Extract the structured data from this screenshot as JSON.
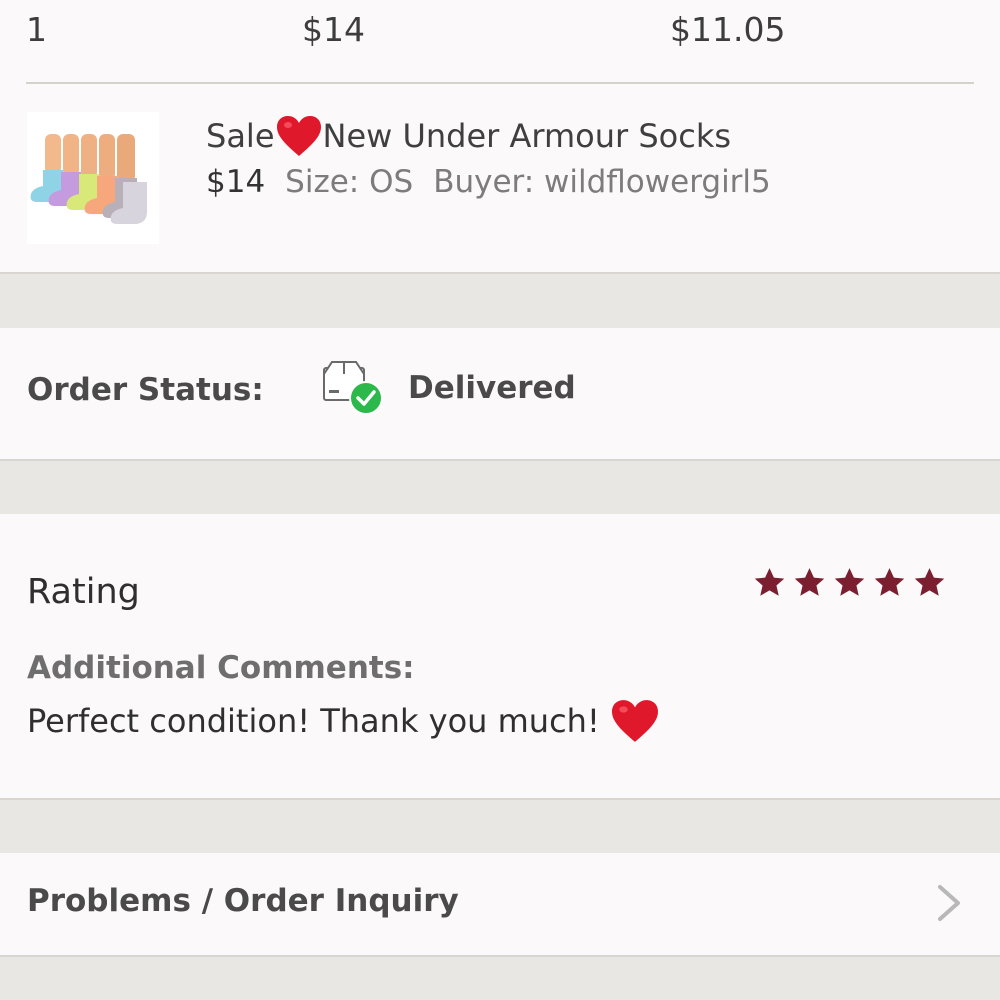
{
  "summary": {
    "quantity": "1",
    "price": "$14",
    "earnings": "$11.05"
  },
  "item": {
    "title_prefix": "Sale",
    "title_suffix": "New Under Armour Socks",
    "price": "$14",
    "size": "Size: OS",
    "buyer": "Buyer: wildflowergirl5"
  },
  "order_status": {
    "label": "Order Status:",
    "value": "Delivered",
    "icon": "package-delivered-icon"
  },
  "rating": {
    "label": "Rating",
    "stars": 5,
    "max_stars": 5,
    "star_color": "#7a1e30",
    "comments_label": "Additional Comments:",
    "comments_text": "Perfect condition! Thank you much!"
  },
  "problems": {
    "label": "Problems / Order Inquiry",
    "icon": "chevron-right-icon"
  },
  "colors": {
    "heart": "#e0182b",
    "check_green": "#2db84c",
    "background": "#e9e7e3"
  }
}
